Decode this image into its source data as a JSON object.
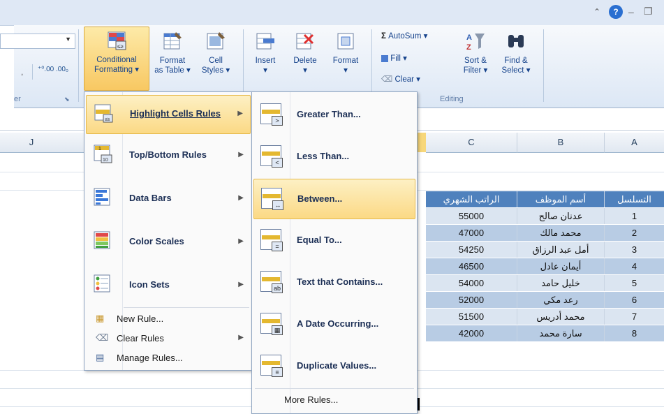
{
  "ribbon": {
    "cond_format_l1": "Conditional",
    "cond_format_l2": "Formatting",
    "format_table_l1": "Format",
    "format_table_l2": "as Table",
    "cell_styles_l1": "Cell",
    "cell_styles_l2": "Styles",
    "insert": "Insert",
    "delete": "Delete",
    "format": "Format",
    "autosum": "AutoSum",
    "fill": "Fill",
    "clear": "Clear",
    "sort_l1": "Sort &",
    "sort_l2": "Filter",
    "find_l1": "Find &",
    "find_l2": "Select",
    "editing_group": "Editing",
    "styles_group_partial": "er"
  },
  "columns": [
    "J",
    "C",
    "B",
    "A"
  ],
  "table": {
    "headers": [
      "الراتب الشهري",
      "أسم الموظف",
      "التسلسل"
    ],
    "rows": [
      [
        "55000",
        "عدنان صالح",
        "1"
      ],
      [
        "47000",
        "محمد مالك",
        "2"
      ],
      [
        "54250",
        "أمل عبد الرزاق",
        "3"
      ],
      [
        "46500",
        "أيمان عادل",
        "4"
      ],
      [
        "54000",
        "خليل حامد",
        "5"
      ],
      [
        "52000",
        "رعد مكي",
        "6"
      ],
      [
        "51500",
        "محمد أدريس",
        "7"
      ],
      [
        "42000",
        "سارة محمد",
        "8"
      ]
    ]
  },
  "menu_main": [
    {
      "label": "Highlight Cells Rules",
      "icon": "highlight-cells-icon"
    },
    {
      "label": "Top/Bottom Rules",
      "icon": "top-bottom-icon"
    },
    {
      "label": "Data Bars",
      "icon": "data-bars-icon"
    },
    {
      "label": "Color Scales",
      "icon": "color-scales-icon"
    },
    {
      "label": "Icon Sets",
      "icon": "icon-sets-icon"
    },
    {
      "label": "New Rule...",
      "icon": "new-rule-icon"
    },
    {
      "label": "Clear Rules",
      "icon": "clear-rules-icon"
    },
    {
      "label": "Manage Rules...",
      "icon": "manage-rules-icon"
    }
  ],
  "menu_sub": [
    {
      "label": "Greater Than..."
    },
    {
      "label": "Less Than..."
    },
    {
      "label": "Between..."
    },
    {
      "label": "Equal To..."
    },
    {
      "label": "Text that Contains..."
    },
    {
      "label": "A Date Occurring..."
    },
    {
      "label": "Duplicate Values..."
    },
    {
      "label": "More Rules..."
    }
  ]
}
